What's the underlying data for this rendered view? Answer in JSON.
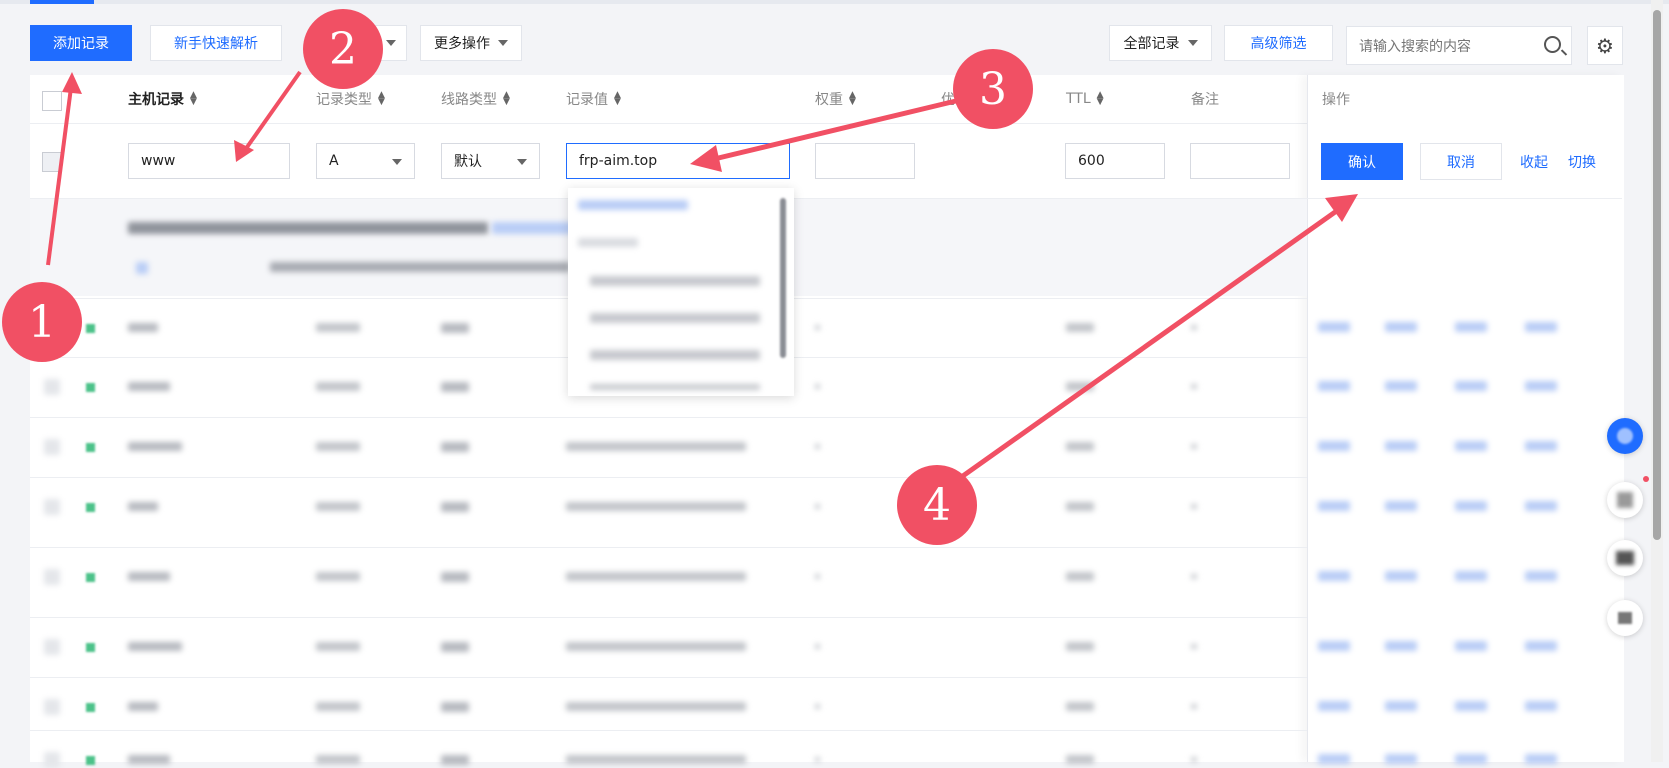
{
  "toolbar": {
    "add_record": "添加记录",
    "quick_parse": "新手快速解析",
    "more_actions": "更多操作",
    "all_records": "全部记录",
    "advanced_filter": "高级筛选",
    "search_placeholder": "请输入搜索的内容"
  },
  "table": {
    "headers": {
      "host": "主机记录",
      "type": "记录类型",
      "line": "线路类型",
      "value": "记录值",
      "weight": "权重",
      "priority": "优",
      "ttl": "TTL",
      "remark": "备注",
      "ops": "操作"
    },
    "edit_row": {
      "host": "www",
      "type": "A",
      "line": "默认",
      "value": "frp-aim.top",
      "weight": "",
      "ttl": "600",
      "remark": "",
      "confirm": "确认",
      "cancel": "取消",
      "collapse": "收起",
      "switch": "切换"
    }
  },
  "annotations": {
    "step1": "1",
    "step2": "2",
    "step3": "3",
    "step4": "4",
    "color": "#f15064"
  },
  "icons": {
    "search": "search-icon",
    "settings": "gear-icon",
    "sort": "sort-icon",
    "caret": "chevron-down-icon"
  },
  "colors": {
    "primary": "#1f6cff",
    "annotation": "#f15064",
    "status_green": "#4cc28a"
  }
}
